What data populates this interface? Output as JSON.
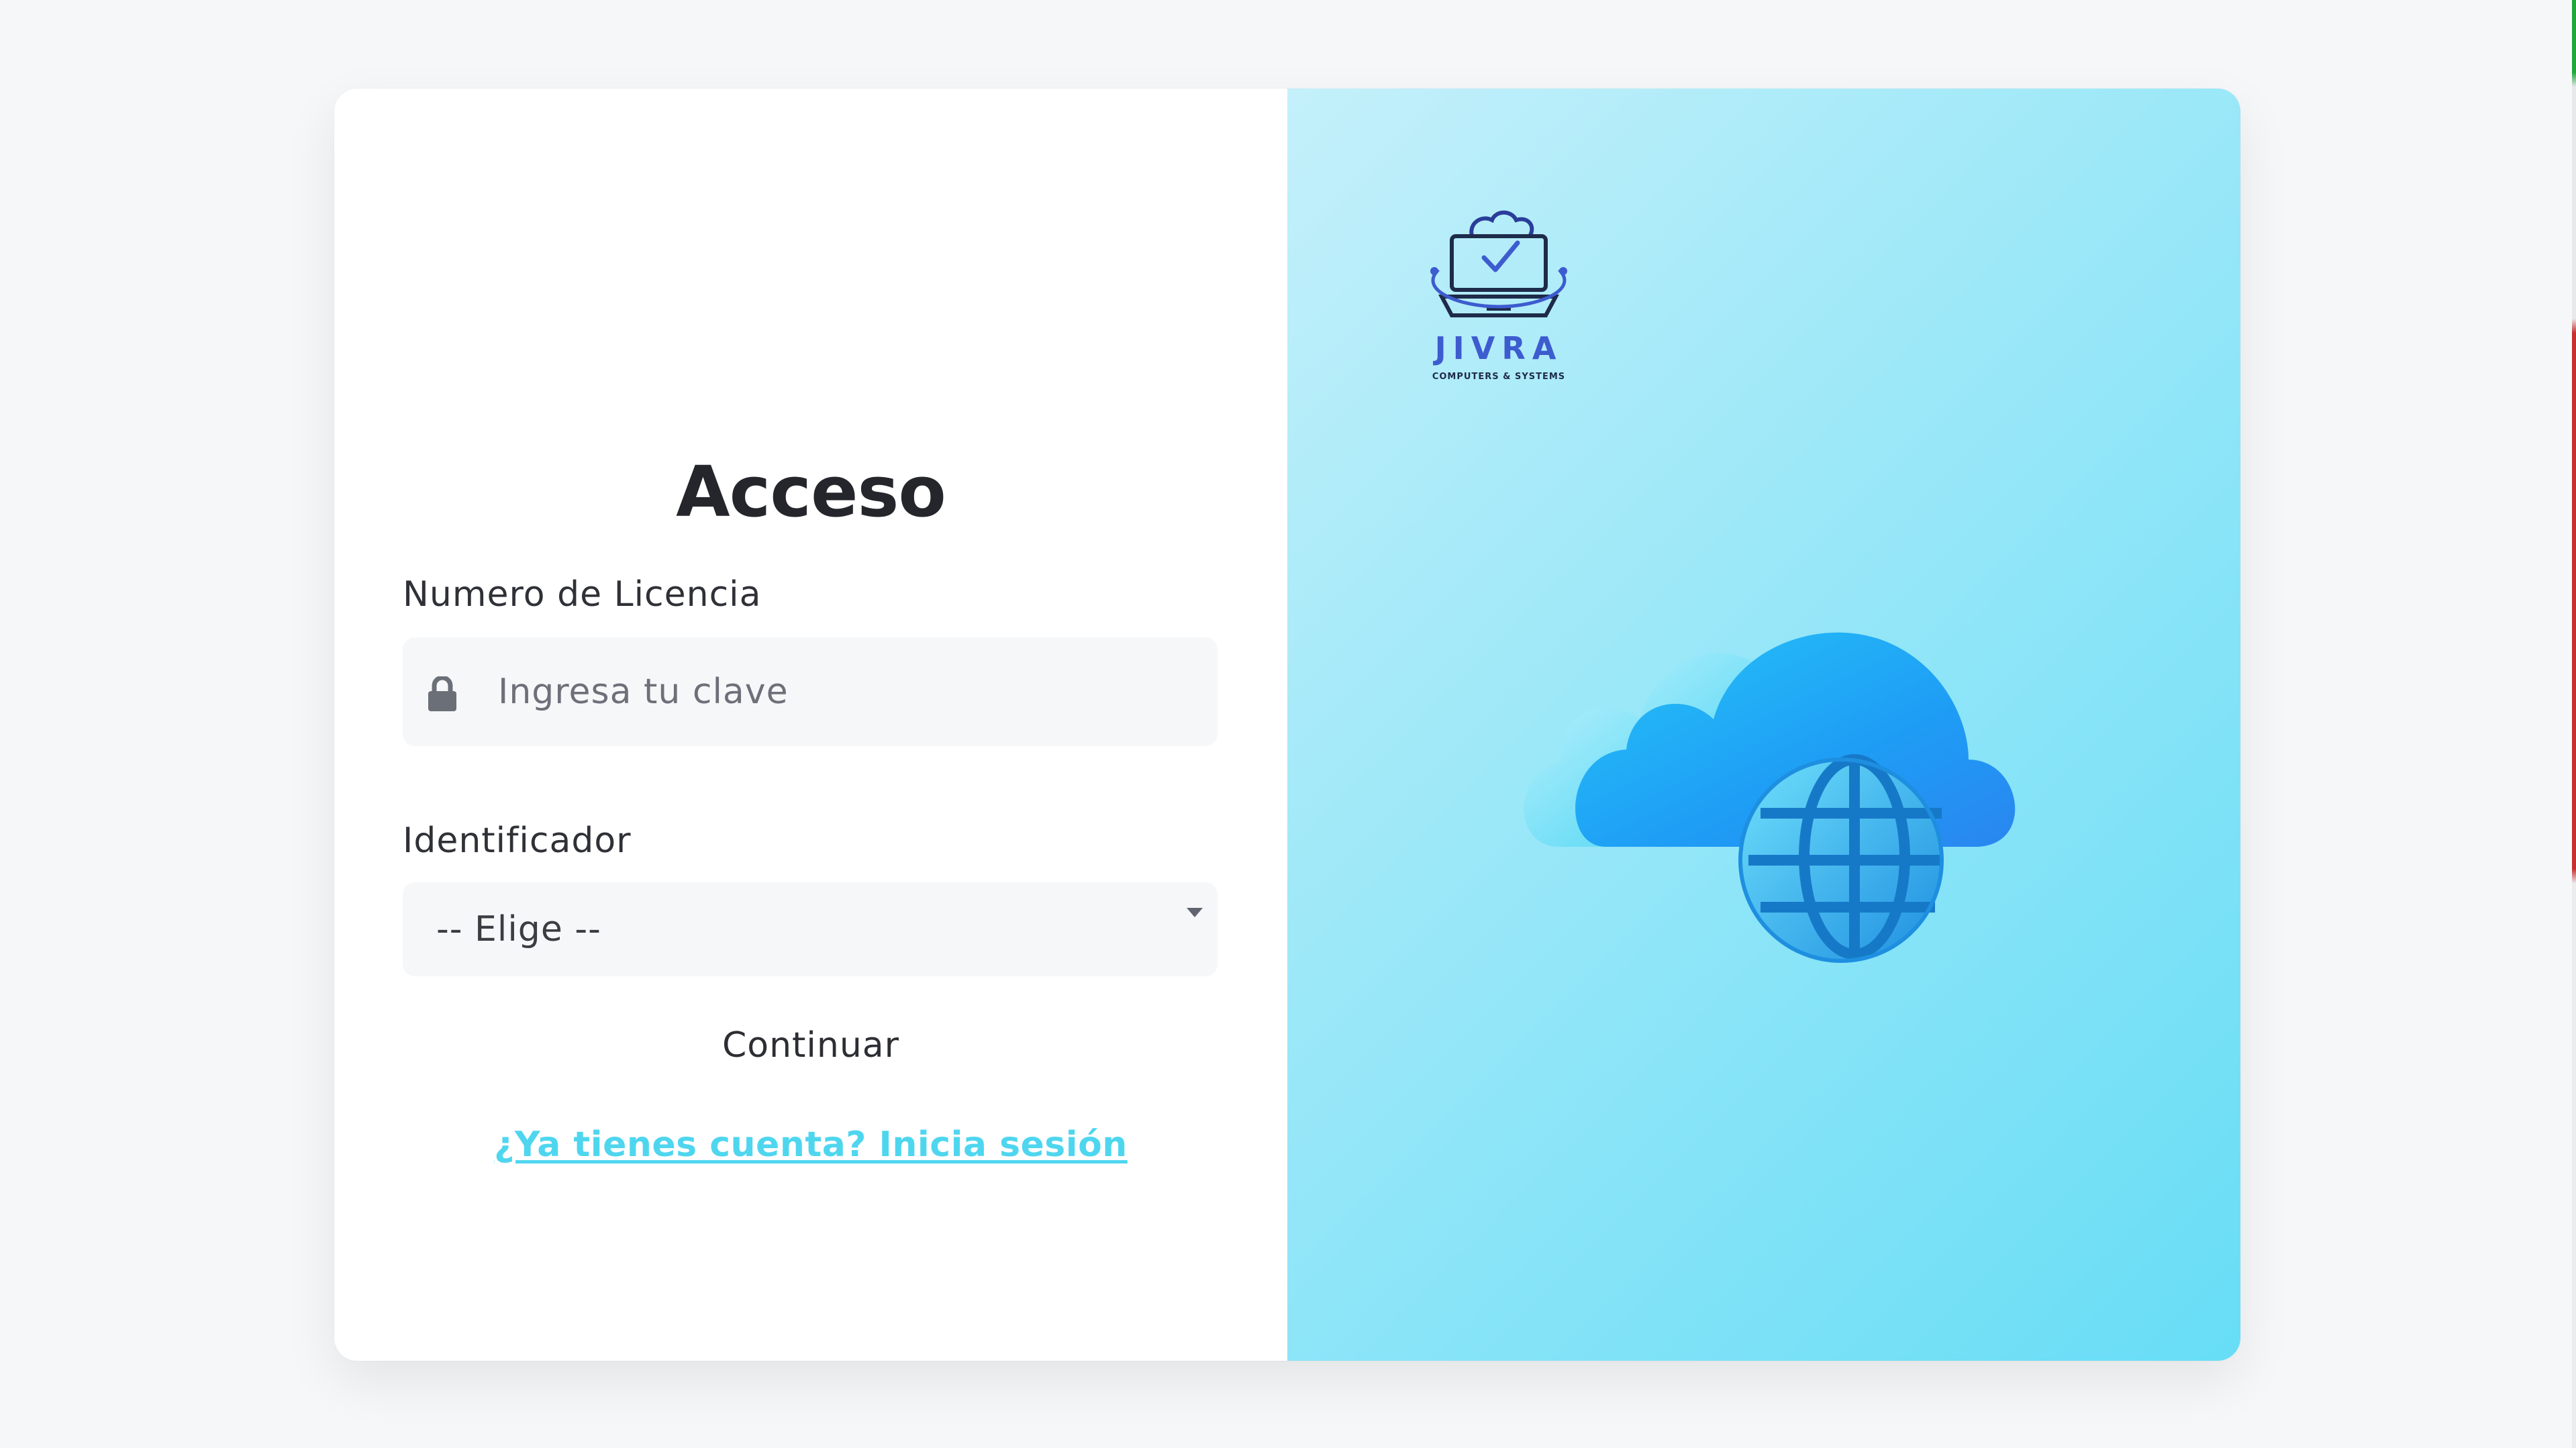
{
  "login": {
    "title": "Acceso",
    "license_label": "Numero de Licencia",
    "license_placeholder": "Ingresa tu clave",
    "license_value": "",
    "identifier_label": "Identificador",
    "identifier_selected": "-- Elige --",
    "continue_label": "Continuar",
    "login_link": "¿Ya tienes cuenta? Inicia sesión"
  },
  "brand": {
    "name": "JIVRA",
    "tagline": "COMPUTERS & SYSTEMS"
  },
  "icons": {
    "lock": "lock-icon",
    "caret": "chevron-down-icon",
    "logo": "laptop-cloud-check-icon",
    "illustration": "cloud-globe-icon"
  },
  "colors": {
    "link": "#4fd6ef",
    "logo_primary": "#3d5ccf",
    "panel_gradient_start": "#c4f0fa",
    "panel_gradient_end": "#67ddf6"
  }
}
